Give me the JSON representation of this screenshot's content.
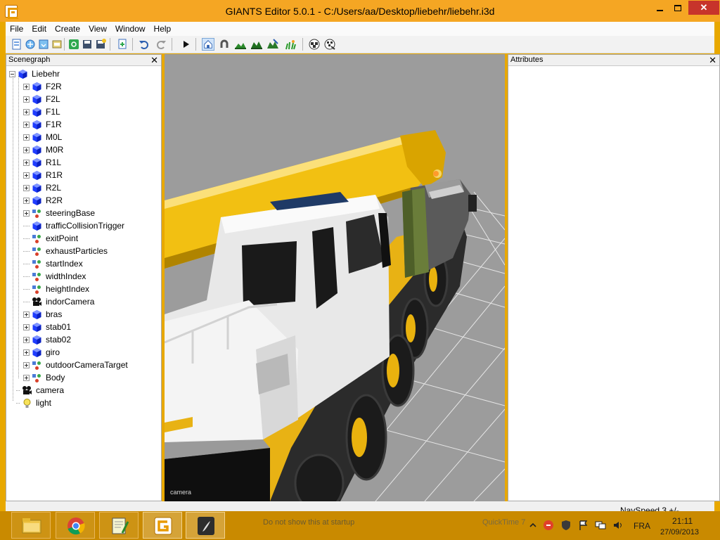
{
  "window": {
    "title": "GIANTS Editor 5.0.1 - C:/Users/aa/Desktop/liebehr/liebehr.i3d",
    "minimize": "minimize",
    "maximize": "maximize",
    "close_glyph": "✕"
  },
  "menu": [
    "File",
    "Edit",
    "Create",
    "View",
    "Window",
    "Help"
  ],
  "toolbar": {
    "buttons": [
      "new-file",
      "open-file",
      "import",
      "refresh",
      "save",
      "save-as",
      "add-node",
      "undo",
      "redo",
      "play",
      "select-mode",
      "move-mode",
      "terrain-sculpt",
      "terrain-paint",
      "foliage-paint",
      "grass-paint",
      "checker-a",
      "checker-b"
    ],
    "pressed": "select-mode"
  },
  "scenegraph": {
    "title": "Scenegraph",
    "close": "✕",
    "root": "Liebehr",
    "children": [
      {
        "label": "F2R",
        "icon": "transform-cube-icon",
        "expandable": true
      },
      {
        "label": "F2L",
        "icon": "transform-cube-icon",
        "expandable": true
      },
      {
        "label": "F1L",
        "icon": "transform-cube-icon",
        "expandable": true
      },
      {
        "label": "F1R",
        "icon": "transform-cube-icon",
        "expandable": true
      },
      {
        "label": "M0L",
        "icon": "transform-cube-icon",
        "expandable": true
      },
      {
        "label": "M0R",
        "icon": "transform-cube-icon",
        "expandable": true
      },
      {
        "label": "R1L",
        "icon": "transform-cube-icon",
        "expandable": true
      },
      {
        "label": "R1R",
        "icon": "transform-cube-icon",
        "expandable": true
      },
      {
        "label": "R2L",
        "icon": "transform-cube-icon",
        "expandable": true
      },
      {
        "label": "R2R",
        "icon": "transform-cube-icon",
        "expandable": true
      },
      {
        "label": "steeringBase",
        "icon": "transform-group-icon",
        "expandable": true
      },
      {
        "label": "trafficCollisionTrigger",
        "icon": "transform-cube-icon",
        "expandable": false
      },
      {
        "label": "exitPoint",
        "icon": "transform-group-icon",
        "expandable": false
      },
      {
        "label": "exhaustParticles",
        "icon": "transform-group-icon",
        "expandable": false
      },
      {
        "label": "startIndex",
        "icon": "transform-group-icon",
        "expandable": false
      },
      {
        "label": "widthIndex",
        "icon": "transform-group-icon",
        "expandable": false
      },
      {
        "label": "heightIndex",
        "icon": "transform-group-icon",
        "expandable": false
      },
      {
        "label": "indorCamera",
        "icon": "camera-icon",
        "expandable": false
      },
      {
        "label": "bras",
        "icon": "transform-cube-icon",
        "expandable": true
      },
      {
        "label": "stab01",
        "icon": "transform-cube-icon",
        "expandable": true
      },
      {
        "label": "stab02",
        "icon": "transform-cube-icon",
        "expandable": true
      },
      {
        "label": "giro",
        "icon": "transform-cube-icon",
        "expandable": true
      },
      {
        "label": "outdoorCameraTarget",
        "icon": "transform-group-icon",
        "expandable": true
      },
      {
        "label": "Body",
        "icon": "transform-group-icon",
        "expandable": true
      }
    ],
    "top_level": [
      {
        "label": "camera",
        "icon": "camera-icon"
      },
      {
        "label": "light",
        "icon": "light-bulb-icon"
      }
    ]
  },
  "viewport": {
    "camera_label": "camera"
  },
  "attributes": {
    "title": "Attributes",
    "close": "✕"
  },
  "status": {
    "navspeed": "NavSpeed 3 +/-"
  },
  "taskbar": {
    "apps": [
      {
        "name": "file-explorer",
        "active": false
      },
      {
        "name": "chrome",
        "active": false
      },
      {
        "name": "notepad-plus-plus",
        "active": false
      },
      {
        "name": "giants-editor",
        "active": true
      },
      {
        "name": "blender-like",
        "active": true
      }
    ],
    "ghost_text": "Do not show this at startup",
    "ghost_quicktime": "QuickTime 7",
    "language": "FRA",
    "time": "21:11",
    "date": "27/09/2013"
  },
  "colors": {
    "titlebar": "#f5a623",
    "taskbar": "#c98a00",
    "node_blue": "#1f3cff",
    "crane_yellow": "#f2c012"
  }
}
